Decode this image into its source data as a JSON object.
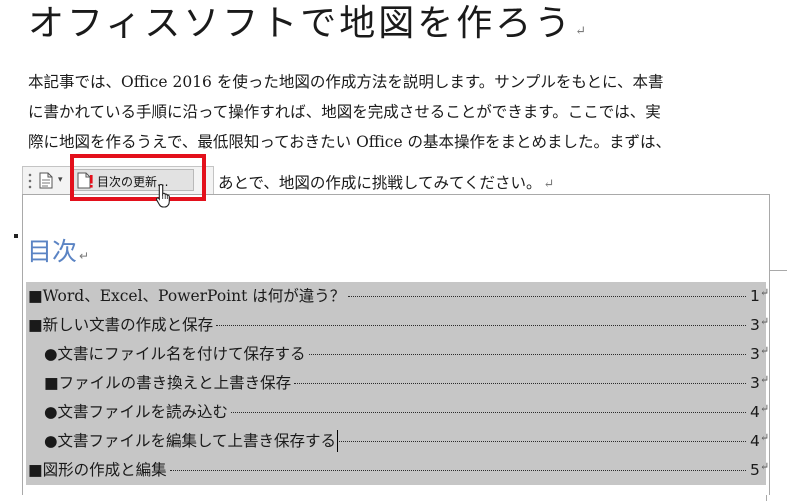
{
  "title": "オフィスソフトで地図を作ろう",
  "paragraph_mark": "↵",
  "body": {
    "line1": "本記事では、Office 2016 を使った地図の作成方法を説明します。サンプルをもとに、本書",
    "line2": "に書かれている手順に沿って操作すれば、地図を完成させることができます。ここでは、実",
    "line3": "際に地図を作るうえで、最低限知っておきたい Office の基本操作をまとめました。まずは、",
    "line4_visible": "あとで、地図の作成に挑戦してみてください。"
  },
  "content_control": {
    "dropdown_glyph": "▾",
    "update_button_label": "目次の更新..."
  },
  "toc": {
    "heading": "目次",
    "entries": [
      {
        "text": "■Word、Excel、PowerPoint は何が違う？",
        "page": "1"
      },
      {
        "text": "■新しい文書の作成と保存",
        "page": "3"
      },
      {
        "text": "●文書にファイル名を付けて保存する",
        "page": "3"
      },
      {
        "text": "■ファイルの書き換えと上書き保存",
        "page": "3"
      },
      {
        "text": "●文書ファイルを読み込む",
        "page": "4"
      },
      {
        "text": "●文書ファイルを編集して上書き保存する",
        "page": "4"
      },
      {
        "text": "■図形の作成と編集",
        "page": "5"
      }
    ]
  },
  "colors": {
    "highlight_box": "#e3101b",
    "toc_heading": "#5b84c4",
    "toc_selection": "#c6c6c6"
  }
}
